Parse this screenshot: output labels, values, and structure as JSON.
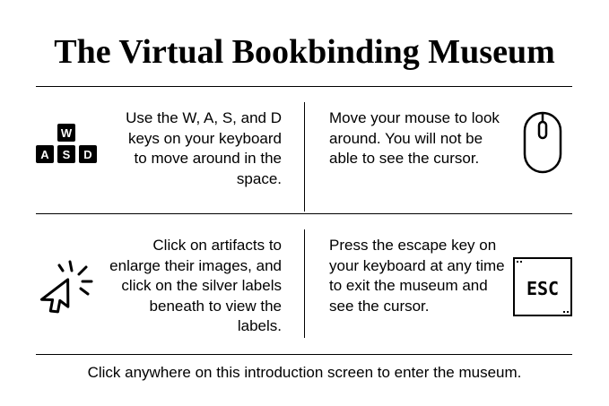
{
  "title": "The Virtual Bookbinding Museum",
  "instructions": [
    {
      "text": "Use the W, A, S, and D keys on your keyboard to move around in the space.",
      "icon": "wasd-keys-icon"
    },
    {
      "text": "Move your mouse to look around. You will not be able to see the cursor.",
      "icon": "mouse-icon"
    },
    {
      "text": "Click on artifacts to enlarge their images, and click on the silver labels beneath to view the labels.",
      "icon": "click-cursor-icon"
    },
    {
      "text": "Press the escape key on your keyboard at any time to exit the museum and see the cursor.",
      "icon": "esc-key-icon"
    }
  ],
  "keys": {
    "w": "W",
    "a": "A",
    "s": "S",
    "d": "D",
    "esc": "ESC"
  },
  "footer": "Click anywhere on this introduction screen to enter the museum."
}
